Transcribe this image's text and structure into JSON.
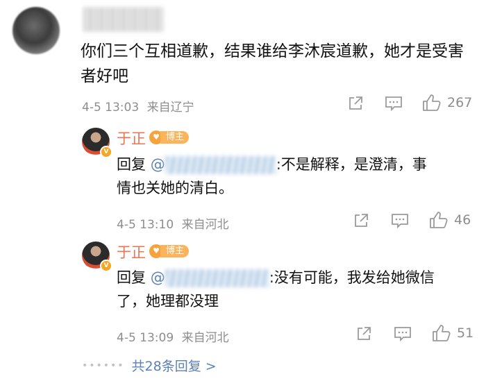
{
  "comment": {
    "text": "你们三个互相道歉，结果谁给李沐宸道歉，她才是受害者好吧",
    "time": "4-5 13:03",
    "location": "来自辽宁",
    "likes": "267"
  },
  "replies": [
    {
      "name": "于正",
      "badge": "博主",
      "prefix": "回复",
      "mention_start": "@",
      "text_line1": ":不是解释，是澄清，事",
      "text_line2": "情也关她的清白。",
      "time": "4-5 13:10",
      "location": "来自河北",
      "likes": "46"
    },
    {
      "name": "于正",
      "badge": "博主",
      "prefix": "回复",
      "mention_start": "@",
      "text_line1": ":没有可能，我发给她微信",
      "text_line2": "了，她理都没理",
      "time": "4-5 13:09",
      "location": "来自河北",
      "likes": "51"
    }
  ],
  "more_replies": {
    "label": "共28条回复 >"
  },
  "icons": {
    "share": "share-icon",
    "comment": "comment-icon",
    "like": "thumbs-up-icon"
  }
}
